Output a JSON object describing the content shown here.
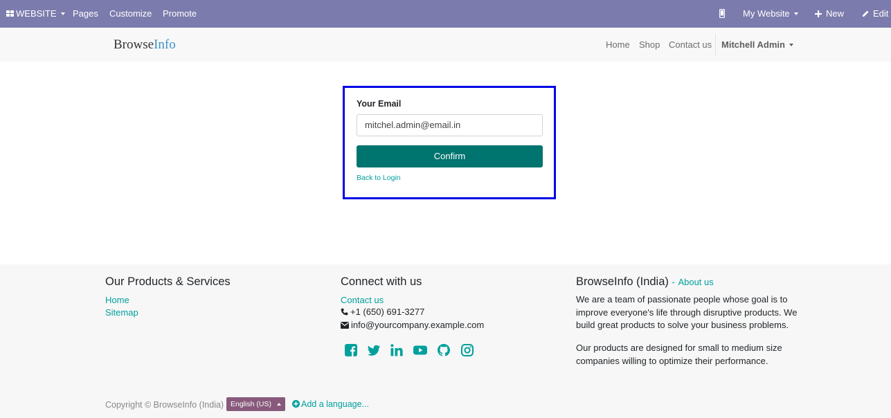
{
  "admin_bar": {
    "website_menu": "WEBSITE",
    "pages": "Pages",
    "customize": "Customize",
    "promote": "Promote",
    "my_website": "My Website",
    "new": "New",
    "edit": "Edit",
    "bg_color": "#7c7bad"
  },
  "header": {
    "logo_part1": "Browse",
    "logo_part2": "Info",
    "nav": [
      "Home",
      "Shop",
      "Contact us"
    ],
    "user": "Mitchell Admin"
  },
  "form": {
    "email_label": "Your Email",
    "email_value": "mitchel.admin@email.in",
    "confirm_label": "Confirm",
    "back_to_login": "Back to Login",
    "border_color": "#0000e6",
    "button_color": "#00746f"
  },
  "footer": {
    "col1": {
      "title": "Our Products & Services",
      "links": [
        "Home",
        "Sitemap"
      ]
    },
    "col2": {
      "title": "Connect with us",
      "contact_link": "Contact us",
      "phone": "+1 (650) 691-3277",
      "email": "info@yourcompany.example.com",
      "social_icons": [
        "facebook-icon",
        "twitter-icon",
        "linkedin-icon",
        "youtube-icon",
        "github-icon",
        "instagram-icon"
      ]
    },
    "col3": {
      "title": "BrowseInfo (India)",
      "title_sep": "-",
      "about_link": "About us",
      "para1": "We are a team of passionate people whose goal is to improve everyone's life through disruptive products. We build great products to solve your business problems.",
      "para2": "Our products are designed for small to medium size companies willing to optimize their performance."
    },
    "copyright": "Copyright © BrowseInfo (India)",
    "language": "English (US)",
    "add_language": "Add a language..."
  }
}
